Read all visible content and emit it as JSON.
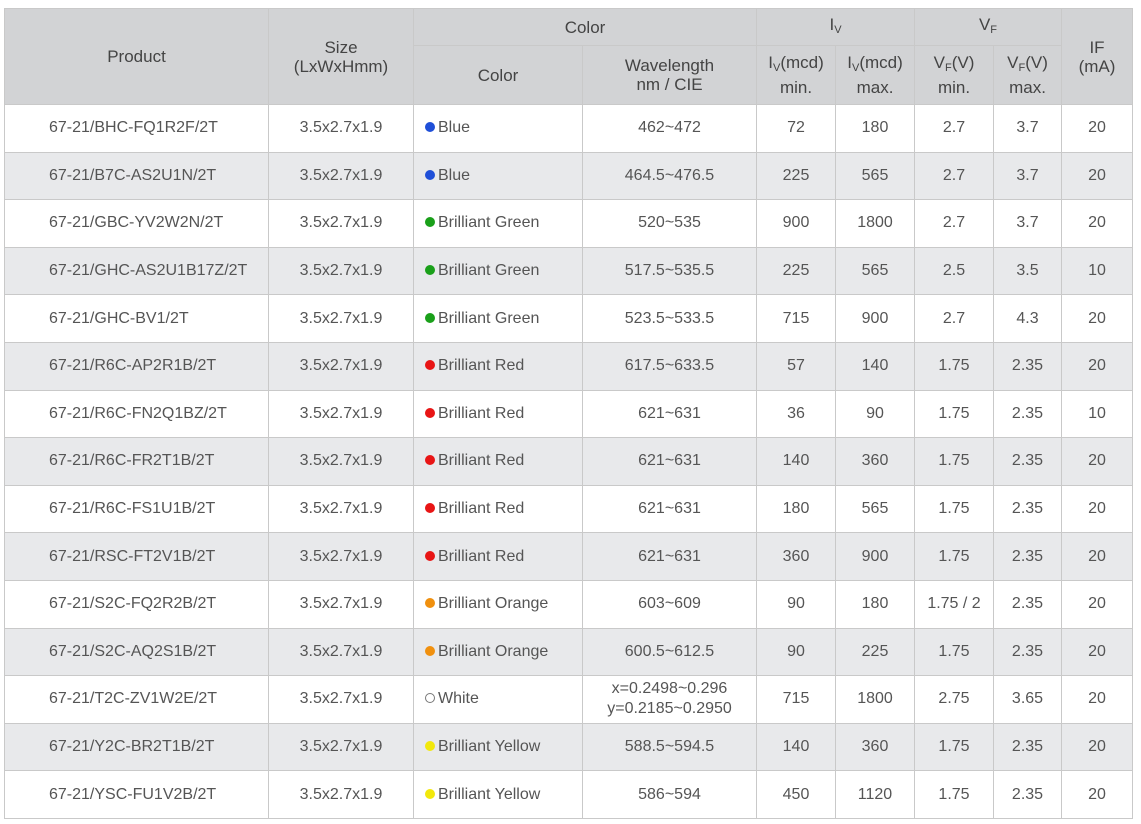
{
  "header": {
    "product": "Product",
    "size_line1": "Size",
    "size_line2": "(LxWxHmm)",
    "color_group": "Color",
    "iv_group": {
      "base": "I",
      "sub": "V"
    },
    "vf_group": {
      "base": "V",
      "sub": "F"
    },
    "if_line1": "IF",
    "if_line2": "(mA)",
    "color_col": "Color",
    "wavelength_line1": "Wavelength",
    "wavelength_line2": "nm / CIE",
    "iv_min": {
      "base": "I",
      "sub": "V",
      "unit": "(mcd)",
      "line2": "min."
    },
    "iv_max": {
      "base": "I",
      "sub": "V",
      "unit": "(mcd)",
      "line2": "max."
    },
    "vf_min": {
      "base": "V",
      "sub": "F",
      "unit": "(V)",
      "line2": "min."
    },
    "vf_max": {
      "base": "V",
      "sub": "F",
      "unit": "(V)",
      "line2": "max."
    }
  },
  "dot_colors": {
    "blue": "#1f4fd8",
    "green": "#1aa01a",
    "red": "#e81515",
    "orange": "#f0900e",
    "white": "#ffffff",
    "yellow": "#f2e80c"
  },
  "rows": [
    {
      "product": "67-21/BHC-FQ1R2F/2T",
      "size": "3.5x2.7x1.9",
      "dot": "blue",
      "color": "Blue",
      "wavelength": "462~472",
      "iv_min": "72",
      "iv_max": "180",
      "vf_min": "2.7",
      "vf_max": "3.7",
      "if": "20"
    },
    {
      "product": "67-21/B7C-AS2U1N/2T",
      "size": "3.5x2.7x1.9",
      "dot": "blue",
      "color": "Blue",
      "wavelength": "464.5~476.5",
      "iv_min": "225",
      "iv_max": "565",
      "vf_min": "2.7",
      "vf_max": "3.7",
      "if": "20"
    },
    {
      "product": "67-21/GBC-YV2W2N/2T",
      "size": "3.5x2.7x1.9",
      "dot": "green",
      "color": "Brilliant Green",
      "wavelength": "520~535",
      "iv_min": "900",
      "iv_max": "1800",
      "vf_min": "2.7",
      "vf_max": "3.7",
      "if": "20"
    },
    {
      "product": "67-21/GHC-AS2U1B17Z/2T",
      "size": "3.5x2.7x1.9",
      "dot": "green",
      "color": "Brilliant Green",
      "wavelength": "517.5~535.5",
      "iv_min": "225",
      "iv_max": "565",
      "vf_min": "2.5",
      "vf_max": "3.5",
      "if": "10"
    },
    {
      "product": "67-21/GHC-BV1/2T",
      "size": "3.5x2.7x1.9",
      "dot": "green",
      "color": "Brilliant Green",
      "wavelength": "523.5~533.5",
      "iv_min": "715",
      "iv_max": "900",
      "vf_min": "2.7",
      "vf_max": "4.3",
      "if": "20"
    },
    {
      "product": "67-21/R6C-AP2R1B/2T",
      "size": "3.5x2.7x1.9",
      "dot": "red",
      "color": "Brilliant Red",
      "wavelength": "617.5~633.5",
      "iv_min": "57",
      "iv_max": "140",
      "vf_min": "1.75",
      "vf_max": "2.35",
      "if": "20"
    },
    {
      "product": "67-21/R6C-FN2Q1BZ/2T",
      "size": "3.5x2.7x1.9",
      "dot": "red",
      "color": "Brilliant Red",
      "wavelength": "621~631",
      "iv_min": "36",
      "iv_max": "90",
      "vf_min": "1.75",
      "vf_max": "2.35",
      "if": "10"
    },
    {
      "product": "67-21/R6C-FR2T1B/2T",
      "size": "3.5x2.7x1.9",
      "dot": "red",
      "color": "Brilliant Red",
      "wavelength": "621~631",
      "iv_min": "140",
      "iv_max": "360",
      "vf_min": "1.75",
      "vf_max": "2.35",
      "if": "20"
    },
    {
      "product": "67-21/R6C-FS1U1B/2T",
      "size": "3.5x2.7x1.9",
      "dot": "red",
      "color": "Brilliant Red",
      "wavelength": "621~631",
      "iv_min": "180",
      "iv_max": "565",
      "vf_min": "1.75",
      "vf_max": "2.35",
      "if": "20"
    },
    {
      "product": "67-21/RSC-FT2V1B/2T",
      "size": "3.5x2.7x1.9",
      "dot": "red",
      "color": "Brilliant Red",
      "wavelength": "621~631",
      "iv_min": "360",
      "iv_max": "900",
      "vf_min": "1.75",
      "vf_max": "2.35",
      "if": "20"
    },
    {
      "product": "67-21/S2C-FQ2R2B/2T",
      "size": "3.5x2.7x1.9",
      "dot": "orange",
      "color": "Brilliant Orange",
      "wavelength": "603~609",
      "iv_min": "90",
      "iv_max": "180",
      "vf_min": "1.75 / 2",
      "vf_max": "2.35",
      "if": "20"
    },
    {
      "product": "67-21/S2C-AQ2S1B/2T",
      "size": "3.5x2.7x1.9",
      "dot": "orange",
      "color": "Brilliant Orange",
      "wavelength": "600.5~612.5",
      "iv_min": "90",
      "iv_max": "225",
      "vf_min": "1.75",
      "vf_max": "2.35",
      "if": "20"
    },
    {
      "product": "67-21/T2C-ZV1W2E/2T",
      "size": "3.5x2.7x1.9",
      "dot": "white",
      "color": "White",
      "wavelength": "x=0.2498~0.296",
      "wavelength2": "y=0.2185~0.2950",
      "iv_min": "715",
      "iv_max": "1800",
      "vf_min": "2.75",
      "vf_max": "3.65",
      "if": "20"
    },
    {
      "product": "67-21/Y2C-BR2T1B/2T",
      "size": "3.5x2.7x1.9",
      "dot": "yellow",
      "color": "Brilliant Yellow",
      "wavelength": "588.5~594.5",
      "iv_min": "140",
      "iv_max": "360",
      "vf_min": "1.75",
      "vf_max": "2.35",
      "if": "20"
    },
    {
      "product": "67-21/YSC-FU1V2B/2T",
      "size": "3.5x2.7x1.9",
      "dot": "yellow",
      "color": "Brilliant Yellow",
      "wavelength": "586~594",
      "iv_min": "450",
      "iv_max": "1120",
      "vf_min": "1.75",
      "vf_max": "2.35",
      "if": "20"
    }
  ]
}
